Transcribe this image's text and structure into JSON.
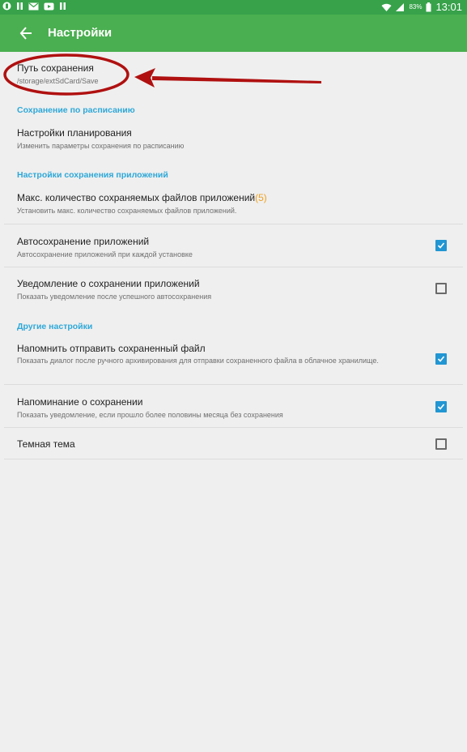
{
  "status_bar": {
    "battery_percent": "83%",
    "time": "13:01"
  },
  "toolbar": {
    "title": "Настройки"
  },
  "items": {
    "save_path": {
      "title": "Путь сохранения",
      "subtitle": "/storage/extSdCard/Save"
    },
    "schedule_settings": {
      "title": "Настройки планирования",
      "subtitle": "Изменить параметры сохранения по расписанию"
    },
    "max_files": {
      "title": "Макс. количество сохраняемых файлов приложений",
      "count": "(5)",
      "subtitle": "Установить макс. количество сохраняемых файлов приложений."
    },
    "autosave": {
      "title": "Автосохранение приложений",
      "subtitle": "Автосохранение приложений при каждой установке",
      "checked": true
    },
    "save_notification": {
      "title": "Уведомление о сохранении приложений",
      "subtitle": "Показать уведомление после успешного автосохранения",
      "checked": false
    },
    "remind_send": {
      "title": "Напомнить отправить сохраненный файл",
      "subtitle": "Показать диалог после ручного архивирования для отправки сохраненного файла в облачное хранилище.",
      "checked": true
    },
    "save_reminder": {
      "title": "Напоминание о сохранении",
      "subtitle": "Показать уведомление, если прошло более половины месяца без сохранения",
      "checked": true
    },
    "dark_theme": {
      "title": "Темная тема",
      "checked": false
    }
  },
  "sections": {
    "schedule": "Сохранение по расписанию",
    "app_save": "Настройки сохранения приложений",
    "other": "Другие настройки"
  },
  "colors": {
    "status_bar": "#37a24a",
    "toolbar": "#4aaf50",
    "section_header": "#2ea8d8",
    "checkbox_checked": "#2196d3",
    "annotation": "#b01010"
  }
}
